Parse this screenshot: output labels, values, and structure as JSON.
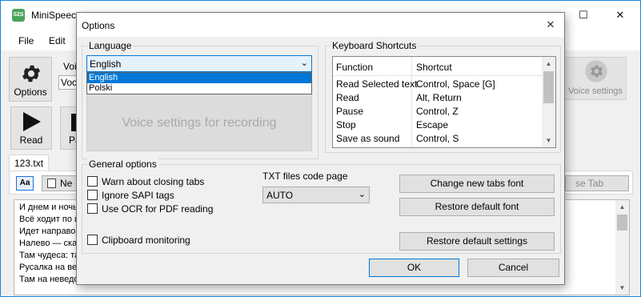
{
  "main_window": {
    "app_icon_text": "S2S",
    "title": "MiniSpeec",
    "window_controls": {
      "minimize": "—",
      "maximize": "☐",
      "close": "✕"
    },
    "menu": [
      "File",
      "Edit"
    ],
    "options_label": "Options",
    "voice_label": "Voi",
    "voice_value": "Voca",
    "read_label": "Read",
    "pause_label": "Pa",
    "voice_settings_label": "Voice settings",
    "doc_tab": "123.txt",
    "aa_label": "Aa",
    "new_tab_label": "Ne",
    "close_tab_label": "se Tab",
    "doc_lines": [
      "И днем и ночью",
      "Всё ходит по ц",
      "Идет направо –",
      "Налево — сказ",
      "Там чудеса: та",
      "Русалка на вет",
      "Там на неведом"
    ]
  },
  "dialog": {
    "title": "Options",
    "close_glyph": "✕",
    "language": {
      "group_label": "Language",
      "selected": "English",
      "options": [
        "English",
        "Polski"
      ],
      "voice_recording_label": "Voice settings for recording"
    },
    "shortcuts": {
      "group_label": "Keyboard Shortcuts",
      "headers": [
        "Function",
        "Shortcut"
      ],
      "rows": [
        [
          "Read Selected text",
          "Control, Space [G]"
        ],
        [
          "Read",
          "Alt, Return"
        ],
        [
          "Pause",
          "Control, Z"
        ],
        [
          "Stop",
          "Escape"
        ],
        [
          "Save as sound",
          "Control, S"
        ]
      ]
    },
    "general": {
      "group_label": "General options",
      "checkboxes": [
        "Warn about closing tabs",
        "Ignore SAPI tags",
        "Use OCR for PDF reading",
        "Clipboard monitoring"
      ],
      "txt_code_page_label": "TXT files code page",
      "txt_code_page_value": "AUTO",
      "change_font_button": "Change new tabs font",
      "restore_font_button": "Restore default font",
      "restore_settings_button": "Restore default settings"
    },
    "ok_button": "OK",
    "cancel_button": "Cancel"
  }
}
